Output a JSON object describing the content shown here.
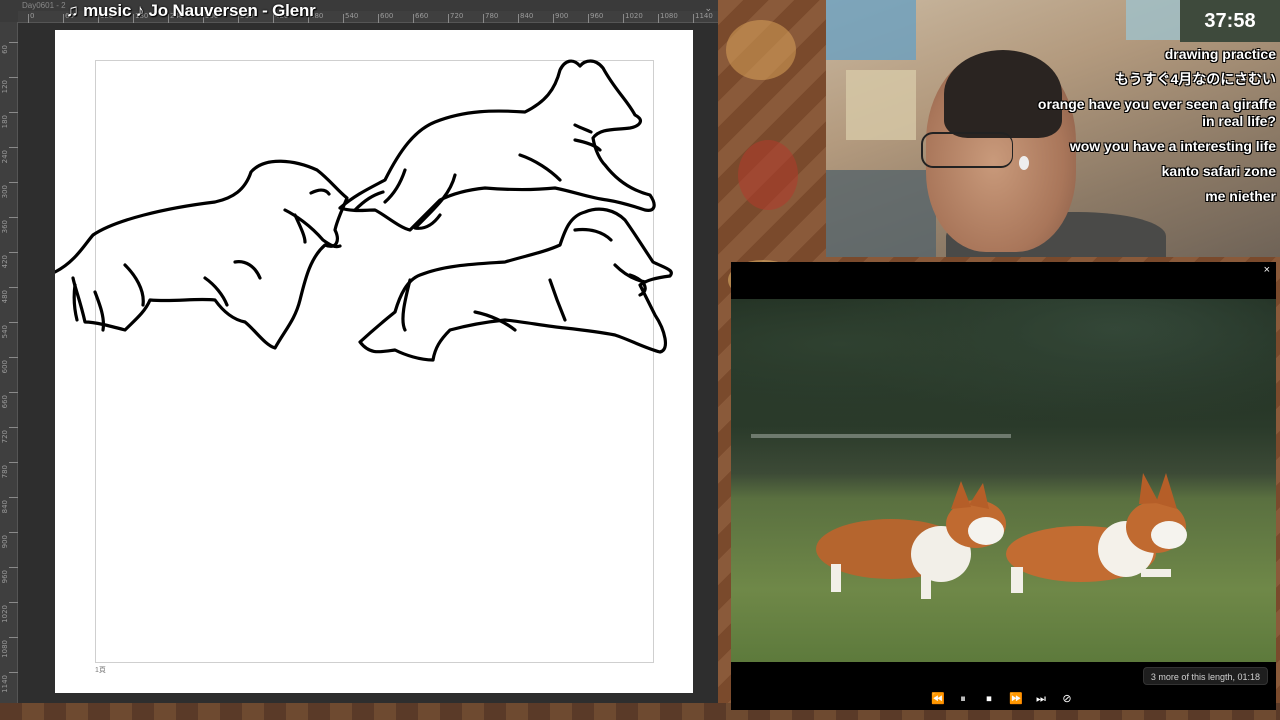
{
  "app": {
    "doc_name": "Day0601 - 2",
    "now_playing": "♫ music ♪ Jo Nauversen - Glenr",
    "ruler_top_labels": [
      "0",
      "60",
      "120",
      "180",
      "240",
      "300",
      "360",
      "420",
      "480",
      "540",
      "600",
      "660",
      "720",
      "780",
      "840",
      "900",
      "960",
      "1020",
      "1080",
      "1140"
    ],
    "ruler_left_labels": [
      "60",
      "120",
      "180",
      "240",
      "300",
      "360",
      "420",
      "480",
      "540",
      "600",
      "660",
      "720",
      "780",
      "840",
      "900",
      "960",
      "1020",
      "1080",
      "1140"
    ],
    "page_marker": "1頁"
  },
  "stream": {
    "timer": "37:58",
    "chat": [
      "drawing practice",
      "もうすぐ4月なのにさむい",
      "orange have you ever seen a giraffe in real life?",
      "wow you have a interesting life",
      "kanto safari zone",
      "me niether"
    ]
  },
  "player": {
    "close_icon": "×",
    "more_info": "3 more of this length, 01:18",
    "controls": [
      {
        "name": "rewind-icon",
        "glyph": "⏪"
      },
      {
        "name": "pause-icon",
        "glyph": "⏸"
      },
      {
        "name": "stop-icon",
        "glyph": "⏹"
      },
      {
        "name": "fast-forward-icon",
        "glyph": "⏩"
      },
      {
        "name": "skip-next-icon",
        "glyph": "⏭"
      },
      {
        "name": "hide-icon",
        "glyph": "⊘"
      }
    ]
  },
  "colors": {
    "timer_bg": "#3e4a3c",
    "corgi_orange": "#b5652e",
    "grass": "#6f8848"
  }
}
